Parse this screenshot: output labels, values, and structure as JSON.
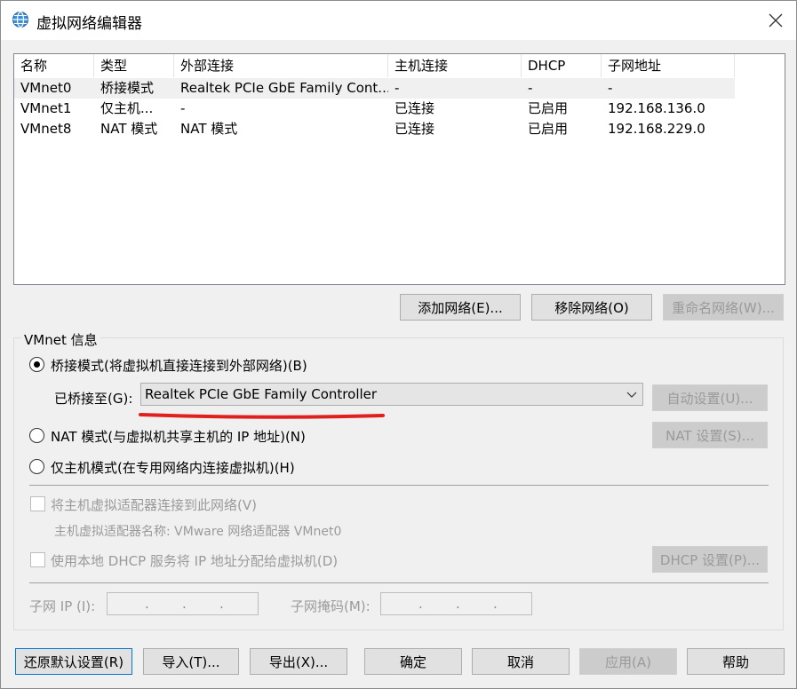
{
  "window": {
    "title": "虚拟网络编辑器",
    "icon": "globe-icon",
    "close": "close-icon"
  },
  "table": {
    "headers": [
      "名称",
      "类型",
      "外部连接",
      "主机连接",
      "DHCP",
      "子网地址"
    ],
    "rows": [
      [
        "VMnet0",
        "桥接模式",
        "Realtek PCIe GbE Family Cont...",
        "-",
        "-",
        "-"
      ],
      [
        "VMnet1",
        "仅主机...",
        "-",
        "已连接",
        "已启用",
        "192.168.136.0"
      ],
      [
        "VMnet8",
        "NAT 模式",
        "NAT 模式",
        "已连接",
        "已启用",
        "192.168.229.0"
      ]
    ],
    "selected_row": 0
  },
  "list_buttons": {
    "add": "添加网络(E)...",
    "remove": "移除网络(O)",
    "rename": "重命名网络(W)..."
  },
  "info": {
    "group_label": "VMnet 信息",
    "bridged_label": "桥接模式(将虚拟机直接连接到外部网络)(B)",
    "bridged_to_label": "已桥接至(G):",
    "bridged_to_value": "Realtek PCIe GbE Family Controller",
    "auto_settings": "自动设置(U)...",
    "nat_label": "NAT 模式(与虚拟机共享主机的 IP 地址)(N)",
    "nat_settings": "NAT 设置(S)...",
    "hostonly_label": "仅主机模式(在专用网络内连接虚拟机)(H)",
    "connect_adapter_label": "将主机虚拟适配器连接到此网络(V)",
    "adapter_name_label": "主机虚拟适配器名称: VMware 网络适配器 VMnet0",
    "dhcp_label": "使用本地 DHCP 服务将 IP 地址分配给虚拟机(D)",
    "dhcp_settings": "DHCP 设置(P)...",
    "subnet_ip_label": "子网 IP (I):",
    "subnet_mask_label": "子网掩码(M):",
    "ip_dots": "."
  },
  "footer": {
    "restore": "还原默认设置(R)",
    "import": "导入(T)...",
    "export": "导出(X)...",
    "ok": "确定",
    "cancel": "取消",
    "apply": "应用(A)",
    "help": "帮助"
  },
  "colors": {
    "annotation_underline": "#e0201c",
    "default_button_border": "#0078d7"
  }
}
